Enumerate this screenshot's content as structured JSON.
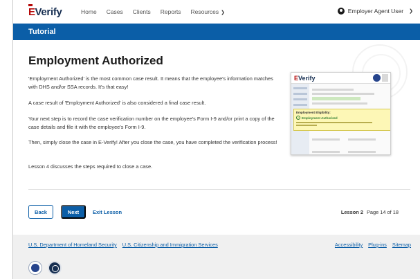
{
  "nav": {
    "logo_e": "E",
    "logo_rest": "Verify",
    "items": [
      "Home",
      "Cases",
      "Clients",
      "Reports",
      "Resources"
    ],
    "user": "Employer Agent User"
  },
  "banner": {
    "title": "Tutorial"
  },
  "content": {
    "heading": "Employment Authorized",
    "paragraphs": [
      "'Employment Authorized' is the most common case result. It means that the employee's information matches with DHS and/or SSA records. It's that easy!",
      "A case result of 'Employment Authorized' is also considered a final case result.",
      "Your next step is to record the case verification number on the employee's Form I-9 and/or print a copy of the case details and file it with the employee's Form I-9.",
      "Then, simply close the case in E-Verify! After you close the case, you have completed the verification process!",
      "Lesson 4 discusses the steps required to close a case."
    ]
  },
  "preview": {
    "logo_e": "E",
    "logo_rest": "Verify",
    "alert_title": "Employment Eligibility:",
    "alert_status": "Employment Authorized"
  },
  "controls": {
    "back": "Back",
    "next": "Next",
    "exit": "Exit Lesson",
    "lesson": "Lesson 2",
    "page": "Page 14 of 18"
  },
  "footer": {
    "left_links": [
      "U.S. Department of Homeland Security",
      "U.S. Citizenship and Immigration Services"
    ],
    "right_links": [
      "Accessibility",
      "Plug-ins",
      "Sitemap"
    ]
  },
  "colors": {
    "primary": "#0b5ea7",
    "brand_red": "#b50909",
    "brand_navy": "#162e51"
  }
}
